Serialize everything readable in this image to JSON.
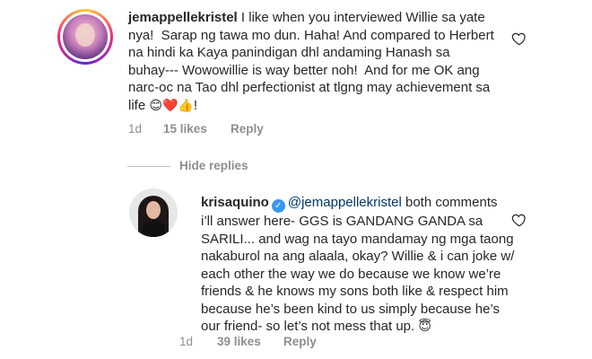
{
  "comments": [
    {
      "username": "jemappellekristel",
      "text_lines": [
        " I like when you interviewed Willie sa yate",
        "nya!  Sarap ng tawa mo dun. Haha! And compared to Herbert",
        "na hindi ka Kaya panindigan dhl andaming Hanash sa",
        "buhay--- Wowowillie is way better noh!  And for me OK ang",
        "narc-oc na Tao dhl perfectionist at tlgng may achievement sa",
        "life "
      ],
      "emojis": [
        "😊",
        "❤️",
        "👍"
      ],
      "trailing": "!",
      "time": "1d",
      "likes": "15 likes",
      "reply": "Reply"
    },
    {
      "username": "krisaquino",
      "mention": "@jemappellekristel",
      "text_lines": [
        " both comments",
        "i’ll answer here- GGS is GANDANG GANDA sa",
        "SARILI... and wag na tayo mandamay ng mga taong",
        "nakaburol na ang alaala, okay? Willie & i can joke w/",
        "each other the way we do because we know we’re",
        "friends & he knows my sons both like & respect him",
        "because he’s been kind to us simply because he’s",
        "our friend- so let’s not mess that up. "
      ],
      "emoji": "😇",
      "time": "1d",
      "likes": "39 likes",
      "reply": "Reply"
    }
  ],
  "hide_replies": "Hide replies",
  "icons": {
    "like": "heart-outline-icon",
    "verified": "verified-badge-icon"
  },
  "colors": {
    "text": "#262626",
    "meta": "#8e8e8e",
    "mention": "#00376b",
    "verified": "#3897f0"
  }
}
